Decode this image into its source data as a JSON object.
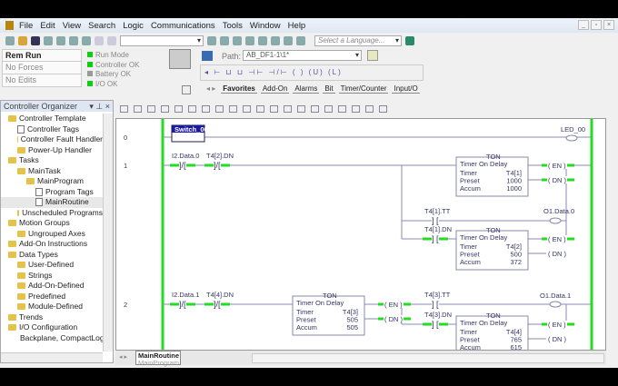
{
  "menu": [
    "File",
    "Edit",
    "View",
    "Search",
    "Logic",
    "Communications",
    "Tools",
    "Window",
    "Help"
  ],
  "window_buttons": [
    "_",
    "▫",
    "×"
  ],
  "toolbar": {
    "language_placeholder": "Select a Language..."
  },
  "status": {
    "mode": "Rem Run",
    "forces": "No Forces",
    "edits": "No Edits"
  },
  "leds": [
    {
      "label": "Run Mode",
      "color": "#22cc22"
    },
    {
      "label": "Controller OK",
      "color": "#22cc22"
    },
    {
      "label": "Battery OK",
      "color": "#999999"
    },
    {
      "label": "I/O OK",
      "color": "#22cc22"
    }
  ],
  "path": {
    "label": "Path:",
    "value": "AB_DF1-1\\1*"
  },
  "instruction_tabs": [
    "Favorites",
    "Add-On",
    "Alarms",
    "Bit",
    "Timer/Counter",
    "Input/O"
  ],
  "organizer": {
    "title": "Controller Organizer",
    "items": [
      {
        "label": "Controller Template",
        "level": 0,
        "icon": "folder"
      },
      {
        "label": "Controller Tags",
        "level": 1,
        "icon": "tags"
      },
      {
        "label": "Controller Fault Handler",
        "level": 1,
        "icon": "folder"
      },
      {
        "label": "Power-Up Handler",
        "level": 1,
        "icon": "folder"
      },
      {
        "label": "Tasks",
        "level": 0,
        "icon": "folder"
      },
      {
        "label": "MainTask",
        "level": 1,
        "icon": "task"
      },
      {
        "label": "MainProgram",
        "level": 2,
        "icon": "program"
      },
      {
        "label": "Program Tags",
        "level": 3,
        "icon": "tags"
      },
      {
        "label": "MainRoutine",
        "level": 3,
        "icon": "routine"
      },
      {
        "label": "Unscheduled Programs",
        "level": 1,
        "icon": "folder"
      },
      {
        "label": "Motion Groups",
        "level": 0,
        "icon": "folder"
      },
      {
        "label": "Ungrouped Axes",
        "level": 1,
        "icon": "folder"
      },
      {
        "label": "Add-On Instructions",
        "level": 0,
        "icon": "folder"
      },
      {
        "label": "Data Types",
        "level": 0,
        "icon": "folder"
      },
      {
        "label": "User-Defined",
        "level": 1,
        "icon": "folder"
      },
      {
        "label": "Strings",
        "level": 1,
        "icon": "folder"
      },
      {
        "label": "Add-On-Defined",
        "level": 1,
        "icon": "folder"
      },
      {
        "label": "Predefined",
        "level": 1,
        "icon": "folder"
      },
      {
        "label": "Module-Defined",
        "level": 1,
        "icon": "folder"
      },
      {
        "label": "Trends",
        "level": 0,
        "icon": "folder"
      },
      {
        "label": "I/O Configuration",
        "level": 0,
        "icon": "folder"
      },
      {
        "label": "Backplane, CompactLogix",
        "level": 1,
        "icon": "backplane"
      }
    ]
  },
  "ladder": {
    "rungs": [
      "0",
      "1",
      "2"
    ],
    "r0": {
      "contact": "Switch_00",
      "coil": "LED_00"
    },
    "r1": {
      "c1": "I2.Data.0",
      "c2": "T4[2].DN",
      "tt": "T4[1].TT",
      "dn": "T4[1].DN",
      "out": "O1.Data.0",
      "ton1": {
        "title": "TON",
        "name": "Timer On Delay",
        "timer": "T4[1]",
        "preset": "1000",
        "accum": "1000"
      },
      "ton2": {
        "title": "TON",
        "name": "Timer On Delay",
        "timer": "T4[2]",
        "preset": "500",
        "accum": "372"
      }
    },
    "r2": {
      "c1": "I2.Data.1",
      "c2": "T4[4].DN",
      "tt": "T4[3].TT",
      "dn": "T4[3].DN",
      "out": "O1.Data.1",
      "ton1": {
        "title": "TON",
        "name": "Timer On Delay",
        "timer": "T4[3]",
        "preset": "505",
        "accum": "505"
      },
      "ton2": {
        "title": "TON",
        "name": "Timer On Delay",
        "timer": "T4[4]",
        "preset": "765",
        "accum": "615"
      }
    },
    "labels": {
      "timer": "Timer",
      "preset": "Preset",
      "accum": "Accum",
      "en": "EN",
      "dn": "DN"
    },
    "energized_color": "#22dd22"
  },
  "routine_tab": {
    "routine": "MainRoutine",
    "program": "MainProgram"
  }
}
